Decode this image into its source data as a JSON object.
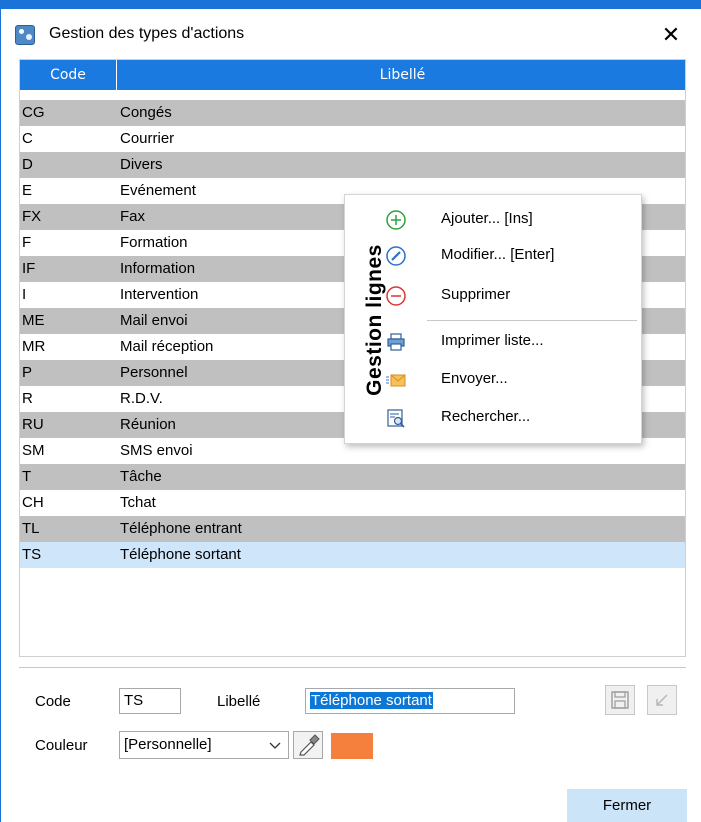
{
  "window": {
    "title": "Gestion des types d'actions",
    "close_glyph": "✕",
    "icon": "app-icon"
  },
  "grid": {
    "columns": [
      "Code",
      "Libellé"
    ],
    "rows": [
      {
        "code": "CG",
        "label": "Congés"
      },
      {
        "code": "C",
        "label": "Courrier"
      },
      {
        "code": "D",
        "label": "Divers"
      },
      {
        "code": "E",
        "label": "Evénement"
      },
      {
        "code": "FX",
        "label": "Fax"
      },
      {
        "code": "F",
        "label": "Formation"
      },
      {
        "code": "IF",
        "label": "Information"
      },
      {
        "code": "I",
        "label": "Intervention"
      },
      {
        "code": "ME",
        "label": "Mail envoi"
      },
      {
        "code": "MR",
        "label": "Mail réception"
      },
      {
        "code": "P",
        "label": "Personnel"
      },
      {
        "code": "R",
        "label": "R.D.V."
      },
      {
        "code": "RU",
        "label": "Réunion"
      },
      {
        "code": "SM",
        "label": "SMS envoi"
      },
      {
        "code": "T",
        "label": "Tâche"
      },
      {
        "code": "CH",
        "label": "Tchat"
      },
      {
        "code": "TL",
        "label": "Téléphone entrant"
      },
      {
        "code": "TS",
        "label": "Téléphone sortant"
      }
    ],
    "selected_code": "TS"
  },
  "context_menu": {
    "side_title": "Gestion lignes",
    "items": [
      {
        "label": "Ajouter... [Ins]",
        "icon": "plus-circle-icon"
      },
      {
        "label": "Modifier... [Enter]",
        "icon": "pencil-circle-icon"
      },
      {
        "label": "Supprimer",
        "icon": "minus-circle-icon"
      },
      {
        "label": "Imprimer liste...",
        "icon": "printer-icon"
      },
      {
        "label": "Envoyer...",
        "icon": "envelope-icon"
      },
      {
        "label": "Rechercher...",
        "icon": "search-doc-icon"
      }
    ]
  },
  "form": {
    "code_label": "Code",
    "code_value": "TS",
    "libelle_label": "Libellé",
    "libelle_value": "Téléphone sortant",
    "couleur_label": "Couleur",
    "couleur_value": "[Personnelle]",
    "couleur_hex": "#f5803e",
    "picker_icon": "eyedropper-icon",
    "save_icon": "save-icon",
    "undo_icon": "undo-icon"
  },
  "footer": {
    "close_button": "Fermer"
  },
  "colors": {
    "header_blue": "#1a7ae0",
    "row_alt": "#c0c0c0",
    "row_selected": "#cfe5fa",
    "button_blue": "#cce4f7",
    "plus_green": "#2aa33a",
    "pencil_blue": "#2f6fc4",
    "minus_red": "#d93636"
  }
}
